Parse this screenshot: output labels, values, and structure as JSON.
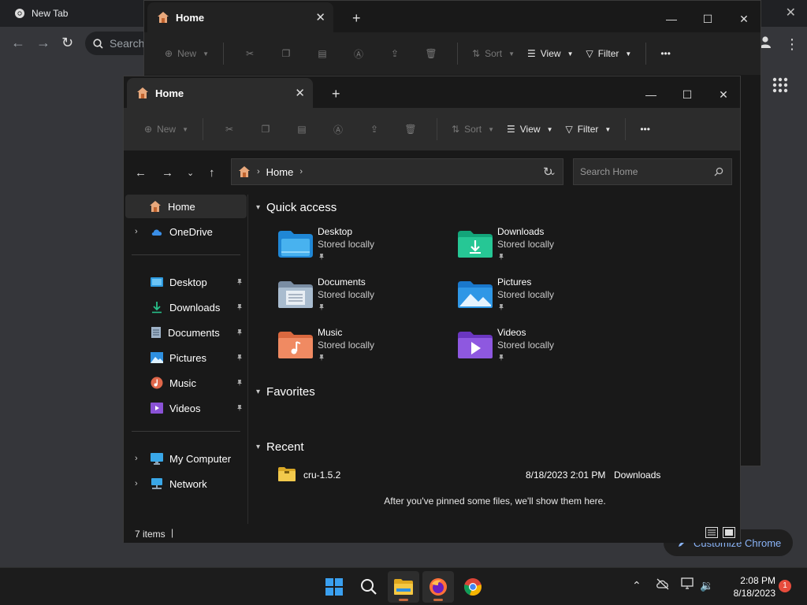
{
  "chrome": {
    "tab_title": "New Tab",
    "search_placeholder": "Search",
    "customize_label": "Customize Chrome"
  },
  "back_window": {
    "tab_label": "Home",
    "toolbar": {
      "new": "New",
      "sort": "Sort",
      "view": "View",
      "filter": "Filter"
    }
  },
  "explorer": {
    "tab_label": "Home",
    "toolbar": {
      "new": "New",
      "sort": "Sort",
      "view": "View",
      "filter": "Filter",
      "more": "•••"
    },
    "address": {
      "current": "Home"
    },
    "search_placeholder": "Search Home",
    "sidebar": {
      "home": "Home",
      "onedrive": "OneDrive",
      "pinned": [
        {
          "label": "Desktop",
          "icon": "desktop-folder-icon"
        },
        {
          "label": "Downloads",
          "icon": "download-icon"
        },
        {
          "label": "Documents",
          "icon": "document-icon"
        },
        {
          "label": "Pictures",
          "icon": "picture-icon"
        },
        {
          "label": "Music",
          "icon": "music-icon"
        },
        {
          "label": "Videos",
          "icon": "video-icon"
        }
      ],
      "my_computer": "My Computer",
      "network": "Network"
    },
    "quick_access": {
      "heading": "Quick access",
      "items": [
        {
          "name": "Desktop",
          "sub": "Stored locally"
        },
        {
          "name": "Downloads",
          "sub": "Stored locally"
        },
        {
          "name": "Documents",
          "sub": "Stored locally"
        },
        {
          "name": "Pictures",
          "sub": "Stored locally"
        },
        {
          "name": "Music",
          "sub": "Stored locally"
        },
        {
          "name": "Videos",
          "sub": "Stored locally"
        }
      ]
    },
    "favorites": {
      "heading": "Favorites",
      "empty_message": "After you've pinned some files, we'll show them here."
    },
    "recent": {
      "heading": "Recent",
      "items": [
        {
          "name": "cru-1.5.2",
          "date": "8/18/2023 2:01 PM",
          "location": "Downloads"
        }
      ]
    },
    "status": {
      "item_count": "7 items"
    }
  },
  "taskbar": {
    "time": "2:08 PM",
    "date": "8/18/2023",
    "notification_count": "1"
  }
}
